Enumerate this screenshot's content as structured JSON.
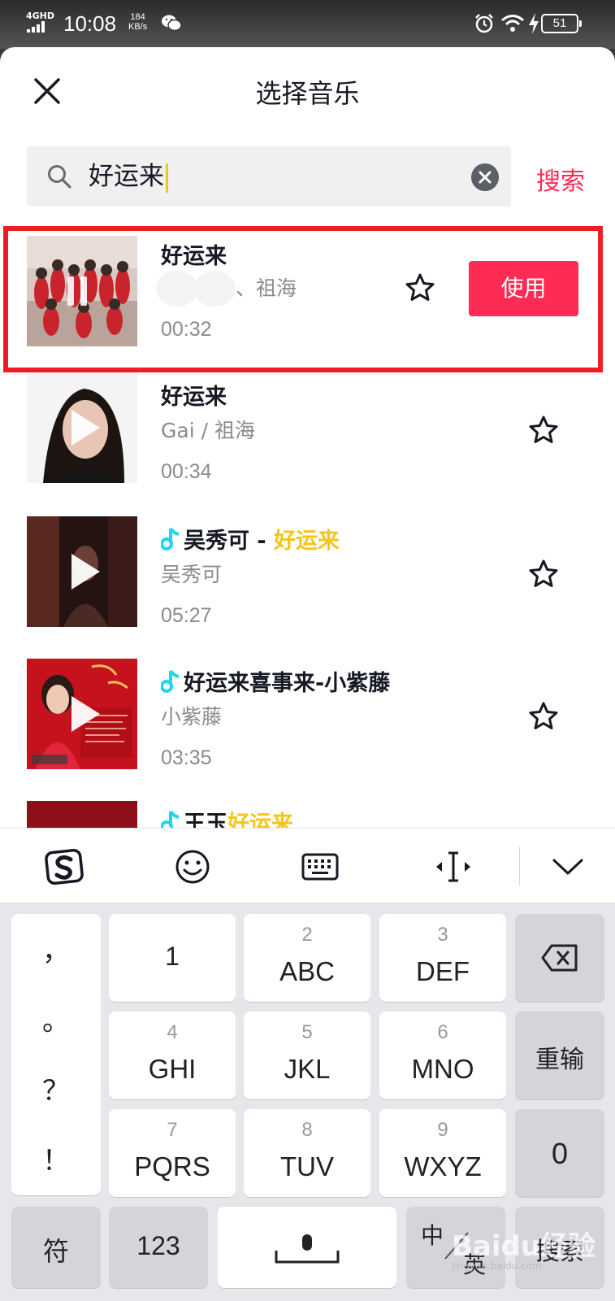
{
  "status_bar": {
    "network": "4GHD",
    "time": "10:08",
    "speed_value": "184",
    "speed_unit": "KB/s",
    "battery": "51",
    "icons": [
      "signal-icon",
      "wechat-icon",
      "alarm-icon",
      "wifi-icon",
      "charging-icon",
      "battery-icon"
    ]
  },
  "header": {
    "title": "选择音乐",
    "close_icon": "close-icon"
  },
  "search": {
    "value": "好运来",
    "button_label": "搜索",
    "icons": [
      "search-icon",
      "clear-icon"
    ]
  },
  "songs": [
    {
      "title": "好运来",
      "artist": "、祖海",
      "duration": "00:32",
      "state": "playing",
      "use_label": "使用"
    },
    {
      "title": "好运来",
      "artist": "Gai / 祖海",
      "duration": "00:34",
      "state": "paused"
    },
    {
      "title_prefix": "吴秀可 - ",
      "title_highlight": "好运来",
      "artist": "吴秀可",
      "duration": "05:27",
      "state": "paused",
      "music_note": true
    },
    {
      "title": "好运来喜事来-小紫藤",
      "artist": "小紫藤",
      "duration": "03:35",
      "state": "paused",
      "music_note": true
    },
    {
      "title_prefix": "王玉",
      "title_highlight": "好运来",
      "state": "partial",
      "music_note": true
    }
  ],
  "accent_colors": {
    "primary": "#fe2c55",
    "highlight": "#f5c518",
    "note": "#20d5ec",
    "frame": "#ee1c25"
  },
  "keyboard": {
    "toolbar_icons": [
      "sogou-logo-icon",
      "emoji-icon",
      "keyboard-icon",
      "cursor-move-icon",
      "collapse-chevron-icon"
    ],
    "punctuation": [
      "，",
      "。",
      "？",
      "！"
    ],
    "keys": [
      {
        "num": "",
        "letters": "1"
      },
      {
        "num": "2",
        "letters": "ABC"
      },
      {
        "num": "3",
        "letters": "DEF"
      },
      {
        "num": "4",
        "letters": "GHI"
      },
      {
        "num": "5",
        "letters": "JKL"
      },
      {
        "num": "6",
        "letters": "MNO"
      },
      {
        "num": "7",
        "letters": "PQRS"
      },
      {
        "num": "8",
        "letters": "TUV"
      },
      {
        "num": "9",
        "letters": "WXYZ"
      }
    ],
    "side": {
      "delete_icon": "backspace-icon",
      "retype": "重输",
      "zero": "0"
    },
    "bottom": {
      "symbols": "符",
      "numbers": "123",
      "space_icon": "microphone-icon",
      "lang_zh": "中",
      "lang_en": "英",
      "enter": "搜索"
    }
  },
  "watermark": {
    "logo": "Baidu经验",
    "url": "jingyan.baidu.com"
  }
}
